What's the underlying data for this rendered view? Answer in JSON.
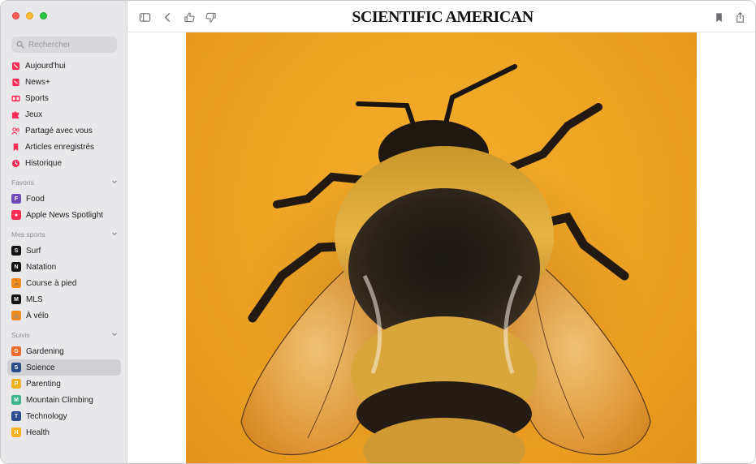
{
  "window": {
    "traffic_lights": [
      "close",
      "minimize",
      "zoom"
    ]
  },
  "sidebar": {
    "search": {
      "placeholder": "Rechercher",
      "value": "",
      "icon": "search-icon"
    },
    "main_items": [
      {
        "label": "Aujourd'hui",
        "icon": "news-icon",
        "color": "#ff2d55"
      },
      {
        "label": "News+",
        "icon": "news-plus-icon",
        "color": "#ff2d55"
      },
      {
        "label": "Sports",
        "icon": "scoreboard-icon",
        "color": "#ff2d55"
      },
      {
        "label": "Jeux",
        "icon": "puzzle-icon",
        "color": "#ff2d55"
      },
      {
        "label": "Partagé avec vous",
        "icon": "shared-people-icon",
        "color": "#ff2d55"
      },
      {
        "label": "Articles enregistrés",
        "icon": "bookmark-icon",
        "color": "#ff2d55"
      },
      {
        "label": "Historique",
        "icon": "clock-icon",
        "color": "#ff2d55"
      }
    ],
    "sections": [
      {
        "title": "Favoris",
        "items": [
          {
            "label": "Food",
            "badge": "F",
            "color": "#6e4bb8"
          },
          {
            "label": "Apple News Spotlight",
            "badge": "●",
            "color": "#ff2d55"
          }
        ]
      },
      {
        "title": "Mes sports",
        "items": [
          {
            "label": "Surf",
            "badge": "S",
            "color": "#111111"
          },
          {
            "label": "Natation",
            "badge": "N",
            "color": "#111111"
          },
          {
            "label": "Course à pied",
            "badge": "🏃",
            "color": "#f08a1c"
          },
          {
            "label": "MLS",
            "badge": "M",
            "color": "#111111"
          },
          {
            "label": "À vélo",
            "badge": "🚲",
            "color": "#f08a1c"
          }
        ]
      },
      {
        "title": "Suivis",
        "items": [
          {
            "label": "Gardening",
            "badge": "G",
            "color": "#f06a2a"
          },
          {
            "label": "Science",
            "badge": "S",
            "color": "#2a4a8c",
            "selected": true
          },
          {
            "label": "Parenting",
            "badge": "P",
            "color": "#f6b21b"
          },
          {
            "label": "Mountain Climbing",
            "badge": "M",
            "color": "#3db38a"
          },
          {
            "label": "Technology",
            "badge": "T",
            "color": "#2a4a8c"
          },
          {
            "label": "Health",
            "badge": "H",
            "color": "#f6b21b"
          }
        ]
      }
    ]
  },
  "toolbar": {
    "masthead": "SCIENTIFIC AMERICAN",
    "buttons": [
      "sidebar-toggle-icon",
      "back-chevron-icon",
      "thumbs-up-icon",
      "thumbs-down-icon",
      "bookmark-icon",
      "share-icon"
    ]
  },
  "article": {
    "hero_image": "bumblebee-on-orange-background"
  },
  "colors": {
    "accent": "#ff2d55",
    "hero_background": "#efa323"
  }
}
